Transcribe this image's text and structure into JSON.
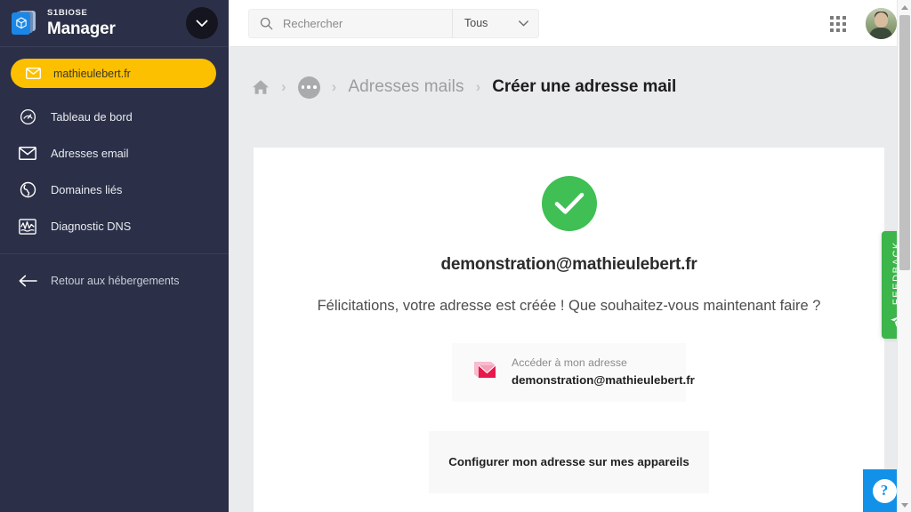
{
  "sidebar": {
    "brand_small": "S1BIOSE",
    "brand_big": "Manager",
    "expand_icon": "chevron-down-icon",
    "domain_pill": {
      "label": "mathieulebert.fr",
      "icon": "envelope-icon",
      "color": "#fcc000"
    },
    "items": [
      {
        "label": "Tableau de bord",
        "icon": "gauge-icon"
      },
      {
        "label": "Adresses email",
        "icon": "envelope-icon"
      },
      {
        "label": "Domaines liés",
        "icon": "globe-icon"
      },
      {
        "label": "Diagnostic DNS",
        "icon": "pulse-icon"
      }
    ],
    "back": {
      "label": "Retour aux hébergements",
      "icon": "arrow-left-icon"
    }
  },
  "topbar": {
    "search": {
      "placeholder": "Rechercher",
      "value": "",
      "icon": "search-icon"
    },
    "filter": {
      "label": "Tous",
      "icon": "chevron-down-icon"
    },
    "apps_icon": "grid-apps-icon",
    "avatar": "user-avatar"
  },
  "breadcrumb": {
    "home_icon": "home-icon",
    "separator": "›",
    "ellipsis_icon": "ellipsis-icon",
    "link": "Adresses mails",
    "current": "Créer une adresse mail"
  },
  "content": {
    "status_icon": "check-circle-icon",
    "status_color": "#3fbf54",
    "email": "demonstration@mathieulebert.fr",
    "message": "Félicitations, votre adresse est créée ! Que souhaitez-vous maintenant faire ?",
    "access_card": {
      "icon": "mail-open-icon",
      "subtitle": "Accéder à mon adresse",
      "title": "demonstration@mathieulebert.fr"
    },
    "configure_card": {
      "title": "Configurer mon adresse sur mes appareils"
    }
  },
  "feedback": {
    "label": "FEEDBACK",
    "icon": "cursor-arrow-icon",
    "color": "#3cb54a"
  },
  "help": {
    "label": "?",
    "icon": "question-mark-icon",
    "color": "#1192e8"
  }
}
